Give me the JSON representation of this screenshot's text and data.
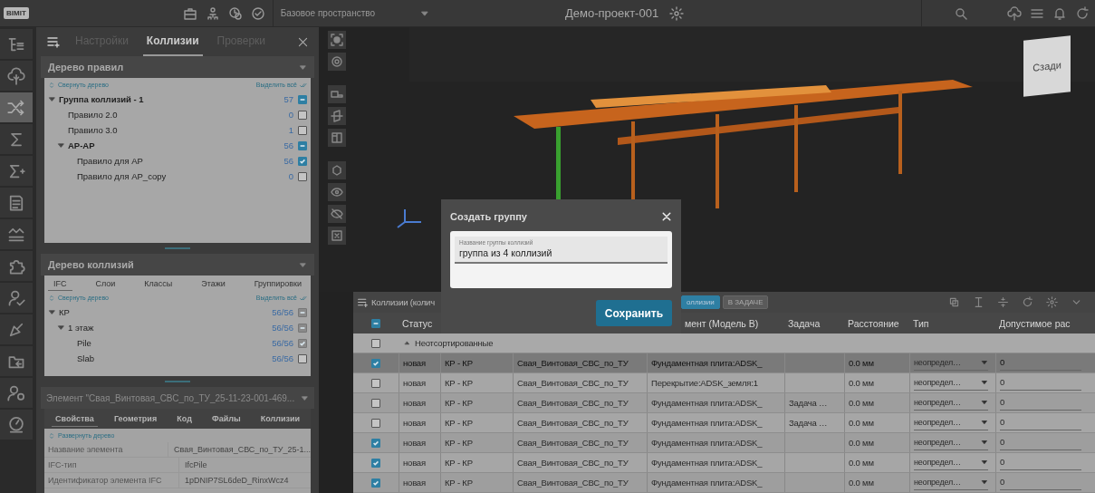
{
  "top_bar": {
    "logo": "BIMIT",
    "workspace": "Базовое пространство",
    "project": "Демо-проект-001"
  },
  "rail": [
    {
      "kind": "tree",
      "selected": false
    },
    {
      "kind": "cloud",
      "selected": false
    },
    {
      "kind": "shuffle",
      "selected": true
    },
    {
      "kind": "sigma",
      "selected": false
    },
    {
      "kind": "sigma_plus",
      "selected": false
    },
    {
      "kind": "document",
      "selected": false
    },
    {
      "kind": "wave",
      "selected": false
    },
    {
      "kind": "puzzle",
      "selected": false
    },
    {
      "kind": "person_check",
      "selected": false
    },
    {
      "kind": "trowel",
      "selected": false
    },
    {
      "kind": "folder",
      "selected": false
    },
    {
      "kind": "person_pin",
      "selected": false
    },
    {
      "kind": "gauge",
      "selected": false
    }
  ],
  "panel": {
    "tabs": [
      {
        "label": "Настройки",
        "selected": false
      },
      {
        "label": "Коллизии",
        "selected": true
      },
      {
        "label": "Проверки",
        "selected": false
      }
    ],
    "rule_tree": {
      "title": "Дерево правил",
      "collapse": "Свернуть дерево",
      "select_all": "Выделить всё",
      "items": [
        {
          "label": "Группа коллизий - 1",
          "count": "57",
          "checked": true,
          "partial": true,
          "expanded": true,
          "children": [
            {
              "label": "Правило 2.0",
              "count": "0",
              "checked": false
            },
            {
              "label": "Правило 3.0",
              "count": "1",
              "checked": false
            },
            {
              "label": "AP-AP",
              "count": "56",
              "checked": true,
              "partial": true,
              "expanded": true,
              "children": [
                {
                  "label": "Правило для АР",
                  "count": "56",
                  "checked": true
                },
                {
                  "label": "Правило для АР_copy",
                  "count": "0",
                  "checked": false
                }
              ]
            }
          ]
        }
      ]
    },
    "collision_tree": {
      "title": "Дерево коллизий",
      "tabs": [
        {
          "label": "IFC",
          "selected": true
        },
        {
          "label": "Слои",
          "selected": false
        },
        {
          "label": "Классы",
          "selected": false
        },
        {
          "label": "Этажи",
          "selected": false
        },
        {
          "label": "Группировки",
          "selected": false
        }
      ],
      "collapse": "Свернуть дерево",
      "select_all": "Выделить всё",
      "items": [
        {
          "label": "КР",
          "count": "56/56",
          "checked": true,
          "partial": true,
          "expanded": true,
          "children": [
            {
              "label": "1 этаж",
              "count": "56/56",
              "checked": true,
              "partial": true,
              "expanded": true,
              "children": [
                {
                  "label": "Pile",
                  "count": "56/56",
                  "checked": true
                },
                {
                  "label": "Slab",
                  "count": "56/56",
                  "checked": false
                }
              ]
            }
          ]
        }
      ]
    },
    "element": {
      "title": "Элемент \"Свая_Винтовая_СВС_по_ТУ_25-11-23-001-469...",
      "tabs": [
        {
          "label": "Свойства",
          "selected": true
        },
        {
          "label": "Геометрия",
          "selected": false
        },
        {
          "label": "Код",
          "selected": false
        },
        {
          "label": "Файлы",
          "selected": false
        },
        {
          "label": "Коллизии",
          "selected": false
        }
      ],
      "expand": "Развернуть дерево",
      "properties": [
        {
          "name": "Название элемента",
          "value": "Свая_Винтовая_СВС_по_ТУ_25-1..."
        },
        {
          "name": "IFC-тип",
          "value": "IfcPile"
        },
        {
          "name": "Идентификатор элемента IFC",
          "value": "1pDNIP7SL6deD_RinxWcz4"
        }
      ]
    }
  },
  "viewport": {
    "kind": "picture",
    "view_cube": "Сзади"
  },
  "collisions": {
    "title": "Коллизии (колич",
    "tags": [
      {
        "label": "оллизии",
        "selected": true
      },
      {
        "label": "В ЗАДАЧЕ",
        "selected": false
      }
    ],
    "columns": {
      "status": "Статус",
      "column_5": "мент (Модель В)",
      "task": "Задача",
      "distance": "Расстояние",
      "type": "Тип",
      "column_9": "Допустимое рас"
    },
    "header_checkbox": {
      "checked": true,
      "partial": true
    },
    "group": {
      "label": "Неотсортированные",
      "checked": false,
      "expanded": true
    },
    "rows": [
      {
        "selected": true,
        "checked": true,
        "status": "новая",
        "column_3": "КР - КР",
        "column_4": "Свая_Винтовая_СВС_по_ТУ",
        "column_5": "Фундаментная плита:ADSK_",
        "distance": "0.0 мм",
        "type": "неопредел…",
        "column_9": "0"
      },
      {
        "selected": false,
        "checked": false,
        "status": "новая",
        "column_3": "КР - КР",
        "column_4": "Свая_Винтовая_СВС_по_ТУ",
        "column_5": "Перекрытие:ADSK_земля:1",
        "distance": "0.0 мм",
        "type": "неопредел…",
        "column_9": "0"
      },
      {
        "selected": false,
        "checked": false,
        "status": "новая",
        "column_3": "КР - КР",
        "column_4": "Свая_Винтовая_СВС_по_ТУ",
        "column_5": "Фундаментная плита:ADSK_",
        "task": "Задача …",
        "distance": "0.0 мм",
        "type": "неопредел…",
        "column_9": "0"
      },
      {
        "selected": false,
        "checked": false,
        "status": "новая",
        "column_3": "КР - КР",
        "column_4": "Свая_Винтовая_СВС_по_ТУ",
        "column_5": "Фундаментная плита:ADSK_",
        "task": "Задача …",
        "distance": "0.0 мм",
        "type": "неопредел…",
        "column_9": "0"
      },
      {
        "selected": false,
        "checked": true,
        "status": "новая",
        "column_3": "КР - КР",
        "column_4": "Свая_Винтовая_СВС_по_ТУ",
        "column_5": "Фундаментная плита:ADSK_",
        "distance": "0.0 мм",
        "type": "неопредел…",
        "column_9": "0"
      },
      {
        "selected": false,
        "checked": true,
        "status": "новая",
        "column_3": "КР - КР",
        "column_4": "Свая_Винтовая_СВС_по_ТУ",
        "column_5": "Фундаментная плита:ADSK_",
        "distance": "0.0 мм",
        "type": "неопредел…",
        "column_9": "0"
      },
      {
        "selected": false,
        "checked": true,
        "status": "новая",
        "column_3": "КР - КР",
        "column_4": "Свая_Винтовая_СВС_по_ТУ",
        "column_5": "Фундаментная плита:ADSK_",
        "distance": "0.0 мм",
        "type": "неопредел…",
        "column_9": "0"
      }
    ]
  },
  "dialog": {
    "title": "Создать группу",
    "field_label": "Название группы коллизий",
    "field_value": "группа из 4 коллизий",
    "button": "Сохранить"
  }
}
